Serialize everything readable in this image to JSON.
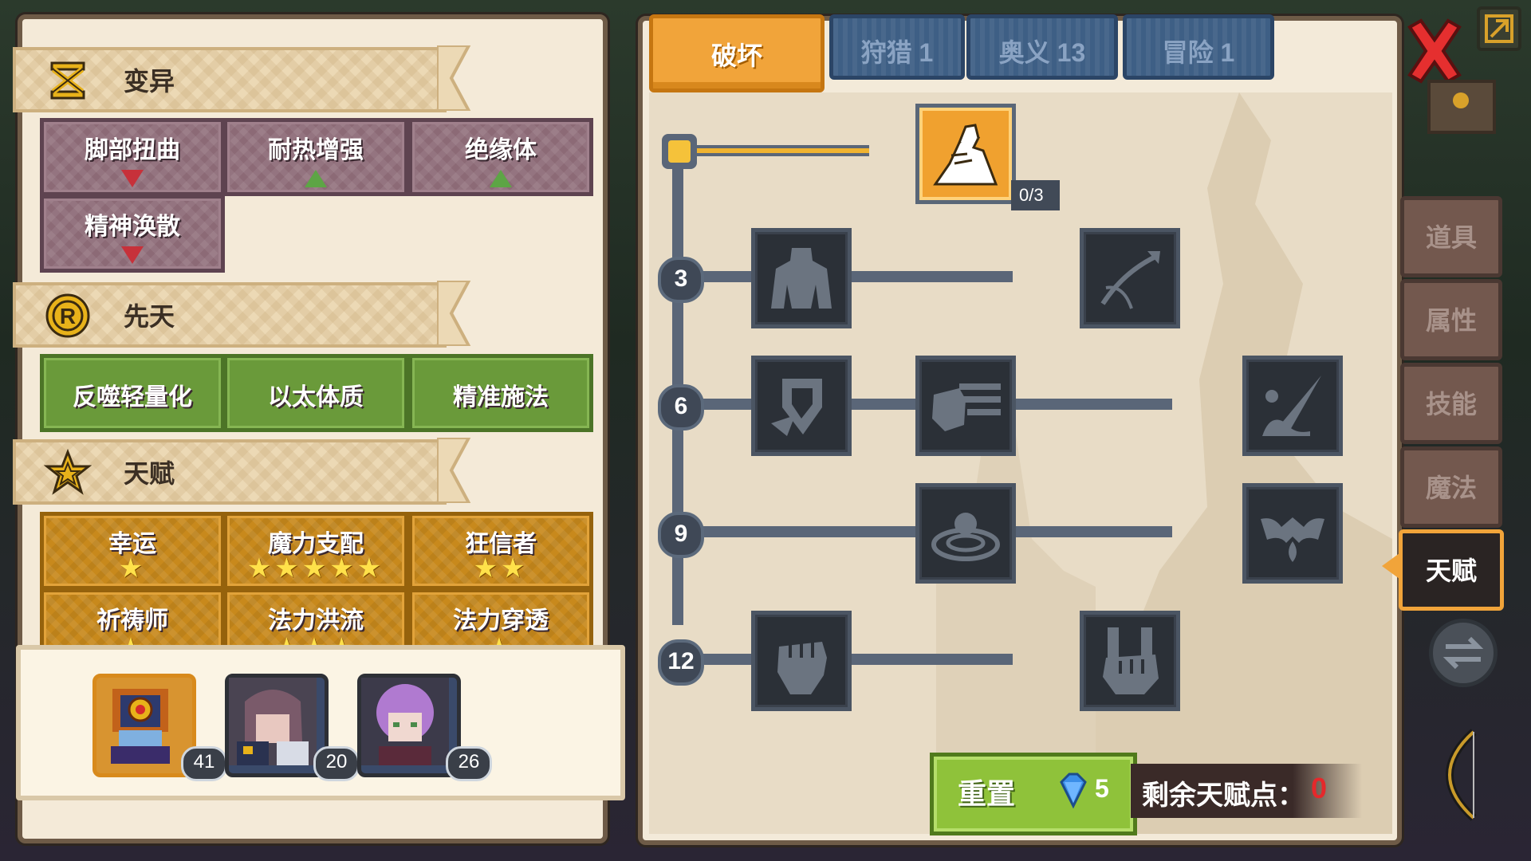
{
  "mutation": {
    "title": "变异",
    "items": [
      {
        "label": "脚部扭曲",
        "dir": "down"
      },
      {
        "label": "耐热增强",
        "dir": "up"
      },
      {
        "label": "绝缘体",
        "dir": "up"
      },
      {
        "label": "精神涣散",
        "dir": "down"
      }
    ]
  },
  "innate": {
    "title": "先天",
    "items": [
      "反噬轻量化",
      "以太体质",
      "精准施法"
    ]
  },
  "talent": {
    "title": "天赋",
    "items": [
      {
        "label": "幸运",
        "stars": "★"
      },
      {
        "label": "魔力支配",
        "stars": "★★★★★"
      },
      {
        "label": "狂信者",
        "stars": "★★"
      },
      {
        "label": "祈祷师",
        "stars": "★"
      },
      {
        "label": "法力洪流",
        "stars": "★★★"
      },
      {
        "label": "法力穿透",
        "stars": "★"
      }
    ]
  },
  "heroes": [
    {
      "level": "41",
      "selected": true
    },
    {
      "level": "20",
      "selected": false
    },
    {
      "level": "26",
      "selected": false
    }
  ],
  "tabs": {
    "active": "破坏",
    "others": [
      "狩猎 1",
      "奥义 13",
      "冒险 1"
    ]
  },
  "tree": {
    "levels": [
      "3",
      "6",
      "9",
      "12"
    ],
    "top_node_rank": "0/3",
    "icons": {
      "top": "arm-wrestle-icon",
      "r3": [
        "muscle-torso-icon",
        "arrow-bow-icon"
      ],
      "r6": [
        "shield-break-icon",
        "punch-fist-icon",
        "splash-blade-icon"
      ],
      "r9": [
        "ground-ring-icon",
        "bat-drop-icon"
      ],
      "r12": [
        "raised-fist-icon",
        "grip-fist-icon"
      ]
    }
  },
  "reset": {
    "label": "重置",
    "cost": "5"
  },
  "remaining": {
    "label": "剩余天赋点：",
    "value": "0"
  },
  "side_tabs": [
    "道具",
    "属性",
    "技能",
    "魔法",
    "天赋"
  ],
  "side_active": "天赋",
  "colors": {
    "accent": "#f1a43a",
    "highlight_node": "#f0a12f",
    "warning": "#e5282b"
  }
}
